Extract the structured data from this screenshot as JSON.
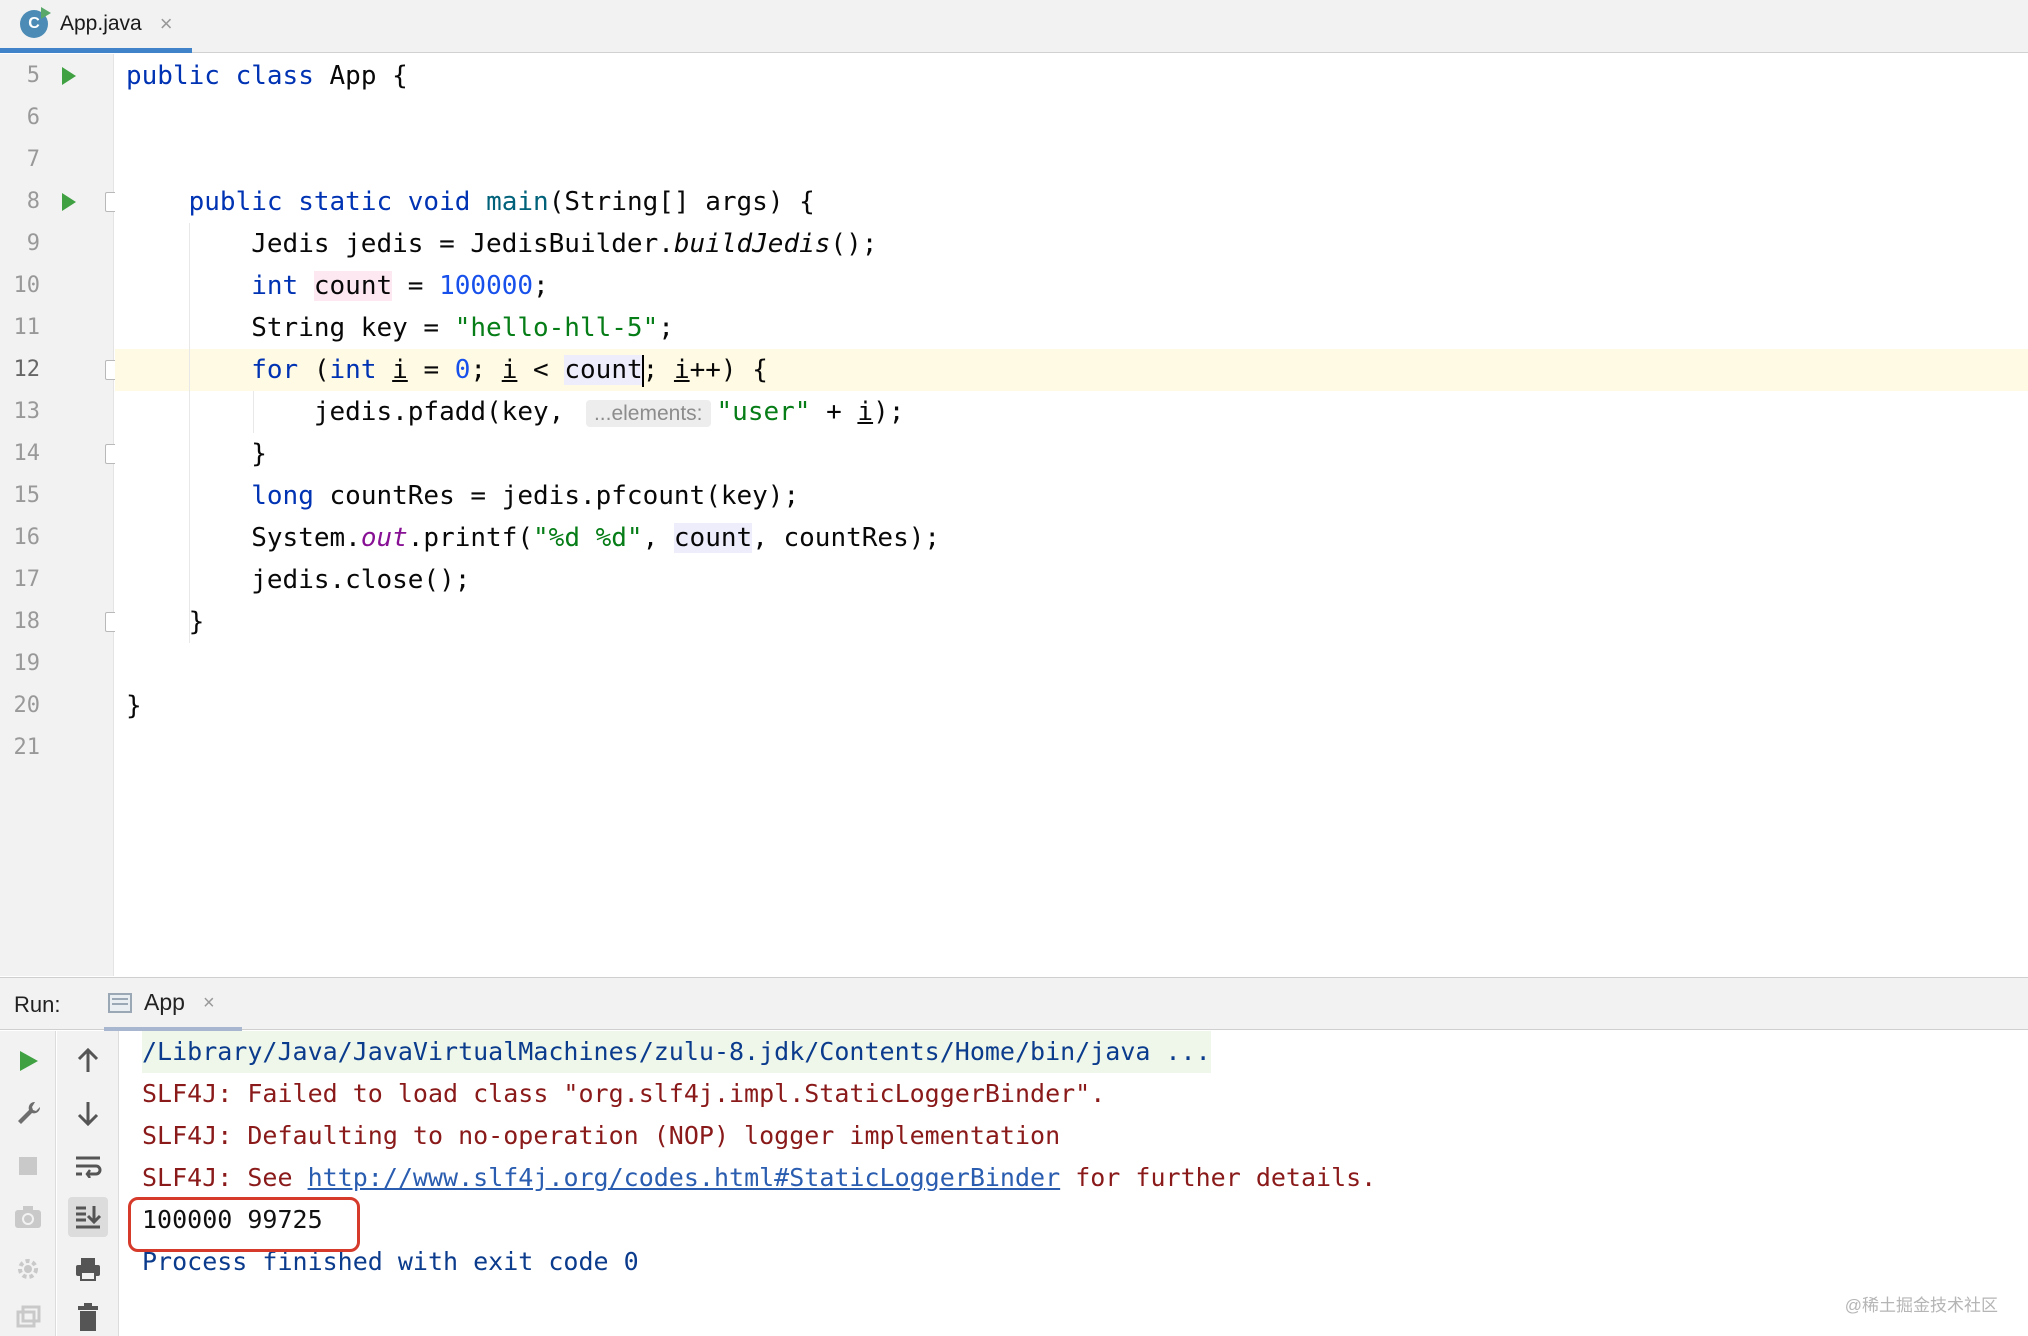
{
  "tab": {
    "title": "App.java",
    "close_glyph": "×",
    "icon": "java-class-icon"
  },
  "editor": {
    "lines": [
      {
        "n": "5",
        "text": "public class App {"
      },
      {
        "n": "6",
        "text": ""
      },
      {
        "n": "7",
        "text": ""
      },
      {
        "n": "8",
        "text": "    public static void main(String[] args) {"
      },
      {
        "n": "9",
        "text": "        Jedis jedis = JedisBuilder.buildJedis();"
      },
      {
        "n": "10",
        "text": "        int count = 100000;"
      },
      {
        "n": "11",
        "text": "        String key = \"hello-hll-5\";"
      },
      {
        "n": "12",
        "text": "        for (int i = 0; i < count; i++) {"
      },
      {
        "n": "13",
        "text": "            jedis.pfadd(key, \"user\" + i);"
      },
      {
        "n": "14",
        "text": "        }"
      },
      {
        "n": "15",
        "text": "        long countRes = jedis.pfcount(key);"
      },
      {
        "n": "16",
        "text": "        System.out.printf(\"%d %d\", count, countRes);"
      },
      {
        "n": "17",
        "text": "        jedis.close();"
      },
      {
        "n": "18",
        "text": "    }"
      },
      {
        "n": "19",
        "text": ""
      },
      {
        "n": "20",
        "text": "}"
      },
      {
        "n": "21",
        "text": ""
      }
    ],
    "tok": {
      "public": "public",
      "class": "class",
      "App": "App",
      "static": "static",
      "void": "void",
      "main": "main",
      "string_args": "(String[] args) {",
      "jedis_decl": "Jedis jedis = JedisBuilder.",
      "buildJedis": "buildJedis",
      "call_end": "();",
      "int": "int",
      "count": "count",
      "eq": " = ",
      "n100000": "100000",
      "semi": ";",
      "string_key": "String key = ",
      "key_str": "\"hello-hll-5\"",
      "for": "for",
      "paren_open": " (",
      "i": "i",
      "zero": "0",
      "lt": " < ",
      "semi_sp": "; ",
      "ipp": "i",
      "pp_close": "++) {",
      "pfadd": "jedis.pfadd(key,",
      "param_hint": "...elements:",
      "user_str": "\"user\"",
      "plus": " + ",
      "close_paren_semi": ");",
      "brace_close": "}",
      "long": "long",
      "countRes_line": " countRes = jedis.pfcount(key);",
      "system": "System.",
      "out": "out",
      "printf": ".printf(",
      "fmt_str": "\"%d %d\"",
      "comma_sp": ", ",
      "countRes_end": "countRes);",
      "close_line": "jedis.close();",
      "class_open": " {"
    }
  },
  "run": {
    "label": "Run:",
    "tab_title": "App",
    "close_glyph": "×",
    "console": {
      "cmd": "/Library/Java/JavaVirtualMachines/zulu-8.jdk/Contents/Home/bin/java ...",
      "err1": "SLF4J: Failed to load class \"org.slf4j.impl.StaticLoggerBinder\".",
      "err2": "SLF4J: Defaulting to no-operation (NOP) logger implementation",
      "err3_prefix": "SLF4J: See ",
      "err3_link": "http://www.slf4j.org/codes.html#StaticLoggerBinder",
      "err3_suffix": " for further details.",
      "output": "100000 99725",
      "exit": "Process finished with exit code 0"
    }
  },
  "watermark": "@稀土掘金技术社区",
  "colors": {
    "keyword": "#0033b3",
    "number": "#1750eb",
    "string": "#067d17",
    "highlight_box": "#d63a2a",
    "run_green": "#3fa141"
  }
}
